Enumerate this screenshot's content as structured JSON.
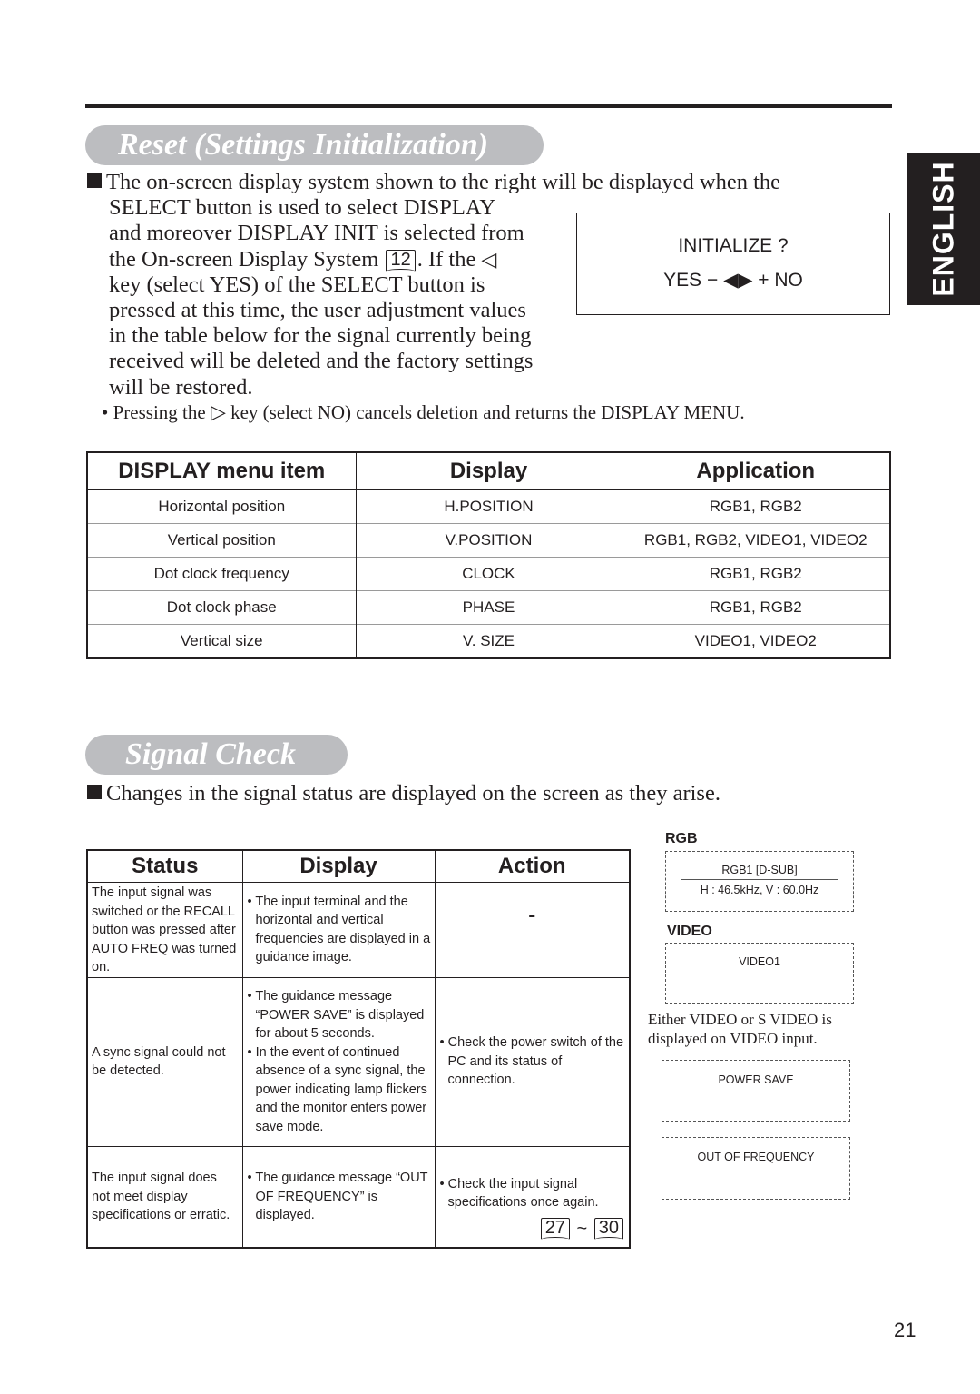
{
  "page_number": "21",
  "language_tab": "ENGLISH",
  "reset_section": {
    "title": "Reset (Settings Initialization)",
    "paragraph": {
      "line1": "The on-screen display system shown to the right will be displayed when the",
      "line2": "SELECT button is used to select DISPLAY",
      "line3": "and moreover DISPLAY INIT is selected from",
      "line4_pre": "the On-screen Display System",
      "line4_ref": "12",
      "line4_post": ". If the",
      "line4_icon": "◁",
      "line5": "key (select YES) of the SELECT button is",
      "line6": "pressed at this time, the user adjustment values",
      "line7": "in the table below for the signal currently being",
      "line8": "received will be deleted and the factory settings",
      "line9": "will be restored."
    },
    "note": {
      "pre": "• Pressing the",
      "icon": "▷",
      "post": "key (select NO) cancels deletion and returns the DISPLAY MENU."
    },
    "osd": {
      "line1": "INITIALIZE ?",
      "line2": "YES − ◀▶ + NO"
    },
    "table": {
      "headers": [
        "DISPLAY menu item",
        "Display",
        "Application"
      ],
      "rows": [
        [
          "Horizontal position",
          "H.POSITION",
          "RGB1, RGB2"
        ],
        [
          "Vertical position",
          "V.POSITION",
          "RGB1, RGB2, VIDEO1, VIDEO2"
        ],
        [
          "Dot clock frequency",
          "CLOCK",
          "RGB1, RGB2"
        ],
        [
          "Dot clock phase",
          "PHASE",
          "RGB1, RGB2"
        ],
        [
          "Vertical size",
          "V. SIZE",
          "VIDEO1, VIDEO2"
        ]
      ]
    }
  },
  "signal_section": {
    "title": "Signal Check",
    "intro": "Changes in the signal status are displayed on the screen as they arise.",
    "table": {
      "headers": [
        "Status",
        "Display",
        "Action"
      ],
      "rows": [
        {
          "status": "The input signal was switched or the RECALL button was pressed after AUTO FREQ was turned on.",
          "display": [
            "The input terminal and the horizontal and vertical frequencies are displayed in a guidance image."
          ],
          "action": "-"
        },
        {
          "status": "A sync signal could not be detected.",
          "display": [
            "The guidance message “POWER SAVE” is displayed for about 5 seconds.",
            "In the event of continued absence of a sync signal, the power indicating lamp flickers and the monitor enters power save mode."
          ],
          "action": "Check the power switch of the PC and its status of connection."
        },
        {
          "status": "The input signal does not meet display specifications or erratic.",
          "display": [
            "The guidance message “OUT OF FREQUENCY” is displayed."
          ],
          "action": "Check the input signal specifications once again.",
          "refs": [
            "27",
            "30"
          ],
          "refs_sep": "~"
        }
      ]
    },
    "guidance": {
      "rgb_label": "RGB",
      "rgb_line1": "RGB1  [D-SUB]",
      "rgb_line2": "H : 46.5kHz, V : 60.0Hz",
      "video_label": "VIDEO",
      "video_line1": "VIDEO1",
      "caption_line1": "Either VIDEO or S VIDEO is",
      "caption_line2": "displayed on VIDEO input.",
      "power_save": "POWER  SAVE",
      "out_of_freq": "OUT OF FREQUENCY"
    }
  }
}
